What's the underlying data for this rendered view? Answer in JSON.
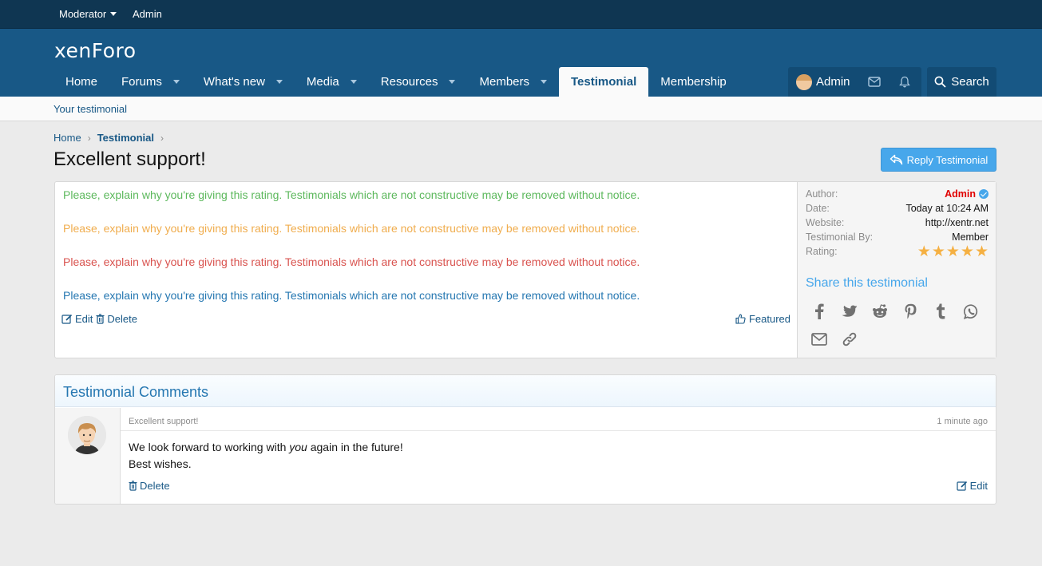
{
  "staff_bar": {
    "moderator": "Moderator",
    "admin": "Admin"
  },
  "header": {
    "logo": "xenForo"
  },
  "nav": {
    "tabs": [
      {
        "label": "Home",
        "has_menu": false
      },
      {
        "label": "Forums",
        "has_menu": true
      },
      {
        "label": "What's new",
        "has_menu": true
      },
      {
        "label": "Media",
        "has_menu": true
      },
      {
        "label": "Resources",
        "has_menu": true
      },
      {
        "label": "Members",
        "has_menu": true
      },
      {
        "label": "Testimonial",
        "has_menu": false,
        "active": true
      },
      {
        "label": "Membership",
        "has_menu": false
      }
    ],
    "account_name": "Admin",
    "search_label": "Search"
  },
  "subnav": {
    "link": "Your testimonial"
  },
  "breadcrumb": {
    "home": "Home",
    "current": "Testimonial"
  },
  "page": {
    "title": "Excellent support!",
    "reply_button": "Reply Testimonial"
  },
  "testimonial": {
    "messages": [
      {
        "text": "Please, explain why you're giving this rating. Testimonials which are not constructive may be removed without notice.",
        "color": "#5cb85c"
      },
      {
        "text": "Please, explain why you're giving this rating. Testimonials which are not constructive may be removed without notice.",
        "color": "#f0ad4e"
      },
      {
        "text": "Please, explain why you're giving this rating. Testimonials which are not constructive may be removed without notice.",
        "color": "#d9534f"
      },
      {
        "text": "Please, explain why you're giving this rating. Testimonials which are not constructive may be removed without notice.",
        "color": "#2577b1"
      }
    ],
    "edit_label": "Edit",
    "delete_label": "Delete",
    "featured_label": "Featured"
  },
  "sidebar": {
    "author_label": "Author:",
    "author_value": "Admin",
    "date_label": "Date:",
    "date_value": "Today at 10:24 AM",
    "website_label": "Website:",
    "website_value": "http://xentr.net",
    "by_label": "Testimonial By:",
    "by_value": "Member",
    "rating_label": "Rating:",
    "rating_value": 5,
    "rating_max": 5,
    "share_title": "Share this testimonial",
    "share_icons": [
      "facebook-icon",
      "twitter-icon",
      "reddit-icon",
      "pinterest-icon",
      "tumblr-icon",
      "whatsapp-icon",
      "email-icon",
      "link-icon"
    ]
  },
  "comments": {
    "title": "Testimonial Comments",
    "items": [
      {
        "subject": "Excellent support!",
        "time": "1 minute ago",
        "line1_before": "We look forward to working with ",
        "line1_em": "you",
        "line1_after": " again in the future!",
        "line2": "Best wishes.",
        "delete_label": "Delete",
        "edit_label": "Edit"
      }
    ]
  },
  "colors": {
    "header": "#185886",
    "staff_bar": "#0f3652",
    "accent": "#47a7eb",
    "link": "#185886"
  }
}
